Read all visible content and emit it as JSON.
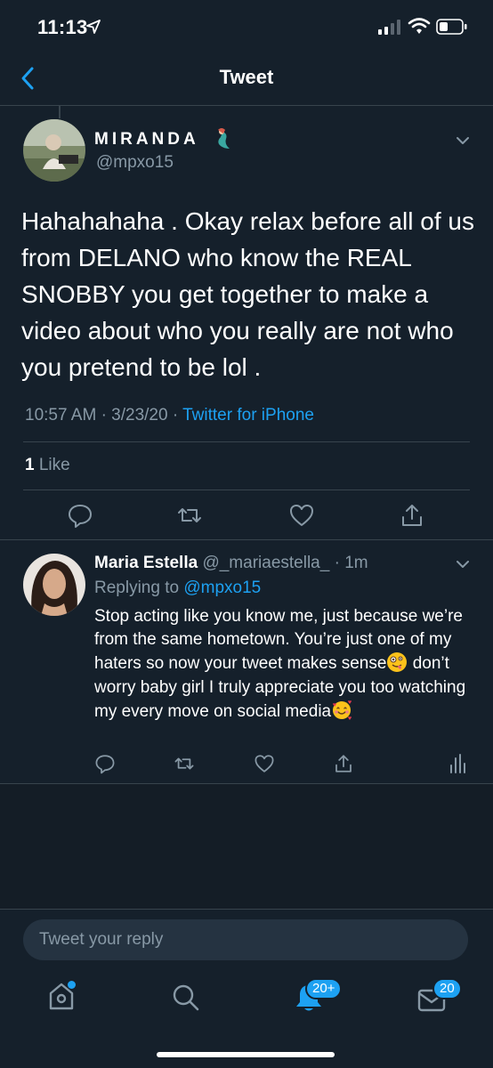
{
  "status": {
    "time": "11:13"
  },
  "header": {
    "title": "Tweet"
  },
  "tweet": {
    "name": "MIRANDA",
    "handle": "@mpxo15",
    "text": "Hahahahaha . Okay relax before all of us from DELANO who know the REAL SNOBBY you get together to make a video about who you really are not who you pretend to be lol .",
    "time": "10:57 AM",
    "date": "3/23/20",
    "source": "Twitter for iPhone",
    "likes_count": "1",
    "likes_label": "Like"
  },
  "reply": {
    "name": "Maria Estella",
    "handle": "@_mariaestella_",
    "age": "1m",
    "replying_prefix": "Replying to",
    "replying_to": "@mpxo15",
    "text_part1": "Stop acting like you know me, just because we’re from the same hometown. You’re just one of my haters so now your tweet makes sense",
    "text_part2": " don’t worry baby girl I truly appreciate you too watching my every move on social media"
  },
  "composer": {
    "placeholder": "Tweet your reply"
  },
  "tabbar": {
    "notifications_badge": "20+",
    "messages_badge": "20"
  },
  "colors": {
    "background": "#15202b",
    "accent": "#1da1f2",
    "muted": "#8899a6",
    "divider": "#38444d"
  },
  "icons": [
    "location-arrow-icon",
    "signal-icon",
    "wifi-icon",
    "battery-icon",
    "back-chevron-icon",
    "chevron-down-icon",
    "reply-icon",
    "retweet-icon",
    "like-icon",
    "share-icon",
    "analytics-icon",
    "home-icon",
    "search-icon",
    "bell-icon",
    "mail-icon"
  ]
}
